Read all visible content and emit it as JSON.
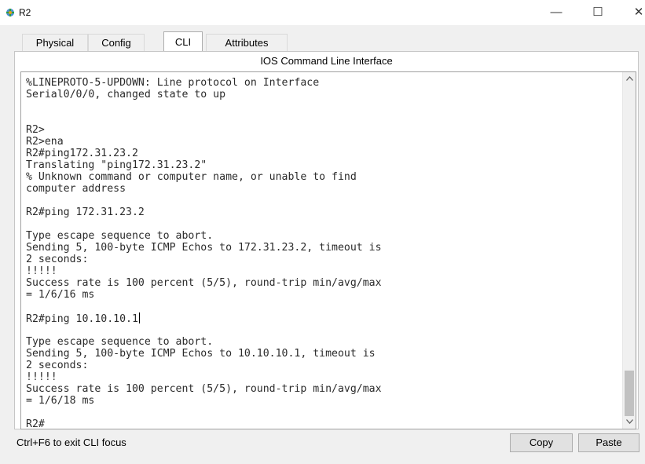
{
  "window": {
    "title": "R2",
    "icon": "router-icon",
    "minimize_label": "—",
    "maximize_label": "☐",
    "close_label": "✕"
  },
  "tabs": [
    {
      "label": "Physical"
    },
    {
      "label": "Config"
    },
    {
      "label": "CLI"
    },
    {
      "label": "Attributes"
    }
  ],
  "active_tab": "CLI",
  "panel": {
    "title": "IOS Command Line Interface"
  },
  "terminal": {
    "lines": [
      "%LINEPROTO-5-UPDOWN: Line protocol on Interface",
      "Serial0/0/0, changed state to up",
      "",
      "",
      "R2>",
      "R2>ena",
      "R2#ping172.31.23.2",
      "Translating \"ping172.31.23.2\"",
      "% Unknown command or computer name, or unable to find",
      "computer address",
      "",
      "R2#ping 172.31.23.2",
      "",
      "Type escape sequence to abort.",
      "Sending 5, 100-byte ICMP Echos to 172.31.23.2, timeout is",
      "2 seconds:",
      "!!!!!",
      "Success rate is 100 percent (5/5), round-trip min/avg/max",
      "= 1/6/16 ms",
      "",
      "R2#ping 10.10.10.1",
      "",
      "Type escape sequence to abort.",
      "Sending 5, 100-byte ICMP Echos to 10.10.10.1, timeout is",
      "2 seconds:",
      "!!!!!",
      "Success rate is 100 percent (5/5), round-trip min/avg/max",
      "= 1/6/18 ms",
      "",
      "R2#"
    ]
  },
  "footer": {
    "hint": "Ctrl+F6 to exit CLI focus",
    "copy_label": "Copy",
    "paste_label": "Paste"
  }
}
